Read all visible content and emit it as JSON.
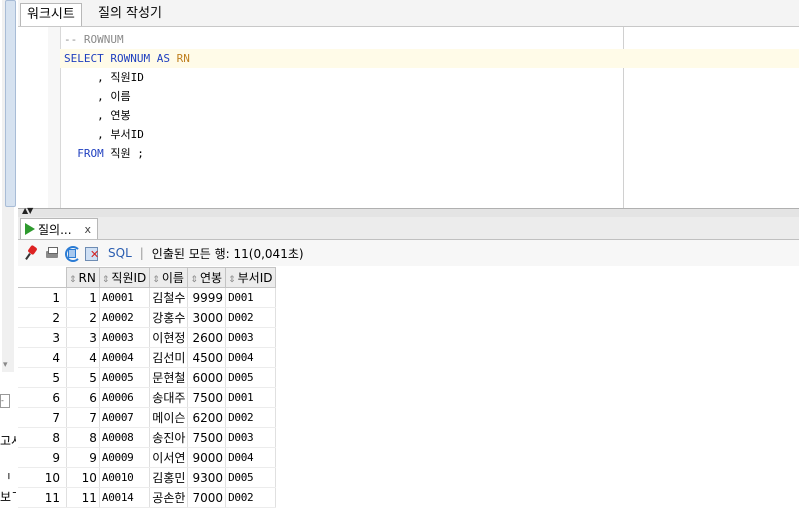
{
  "worksheet": {
    "tabs": [
      {
        "label": "워크시트"
      },
      {
        "label": "질의 작성기"
      }
    ]
  },
  "editor": {
    "lines": [
      {
        "type": "comment",
        "text": "-- ROWNUM"
      },
      {
        "type": "select",
        "kw": "SELECT ROWNUM AS",
        "alias": "RN"
      },
      {
        "type": "plain",
        "text": "     , 직원ID"
      },
      {
        "type": "plain",
        "text": "     , 이름"
      },
      {
        "type": "plain",
        "text": "     , 연봉"
      },
      {
        "type": "plain",
        "text": "     , 부서ID"
      },
      {
        "type": "from",
        "kw": "FROM",
        "rest": " 직원 ;"
      }
    ]
  },
  "left_panel": {
    "cut_texts": [
      "고시",
      "ᅵ",
      "보ᄀ"
    ]
  },
  "results": {
    "tab_label": "질의...",
    "tab_close": "x",
    "toolbar": {
      "sql_label": "SQL",
      "separator": "|",
      "status": "인출된 모든 행: 11(0,041초)"
    },
    "columns": [
      "RN",
      "직원ID",
      "이름",
      "연봉",
      "부서ID"
    ],
    "rows": [
      {
        "n": "1",
        "RN": "1",
        "ID": "A0001",
        "NAME": "김철수",
        "SAL": "9999",
        "DEPT": "D001"
      },
      {
        "n": "2",
        "RN": "2",
        "ID": "A0002",
        "NAME": "강홍수",
        "SAL": "3000",
        "DEPT": "D002"
      },
      {
        "n": "3",
        "RN": "3",
        "ID": "A0003",
        "NAME": "이현정",
        "SAL": "2600",
        "DEPT": "D003"
      },
      {
        "n": "4",
        "RN": "4",
        "ID": "A0004",
        "NAME": "김선미",
        "SAL": "4500",
        "DEPT": "D004"
      },
      {
        "n": "5",
        "RN": "5",
        "ID": "A0005",
        "NAME": "문현철",
        "SAL": "6000",
        "DEPT": "D005"
      },
      {
        "n": "6",
        "RN": "6",
        "ID": "A0006",
        "NAME": "송대주",
        "SAL": "7500",
        "DEPT": "D001"
      },
      {
        "n": "7",
        "RN": "7",
        "ID": "A0007",
        "NAME": "메이슨",
        "SAL": "6200",
        "DEPT": "D002"
      },
      {
        "n": "8",
        "RN": "8",
        "ID": "A0008",
        "NAME": "송진아",
        "SAL": "7500",
        "DEPT": "D003"
      },
      {
        "n": "9",
        "RN": "9",
        "ID": "A0009",
        "NAME": "이서연",
        "SAL": "9000",
        "DEPT": "D004"
      },
      {
        "n": "10",
        "RN": "10",
        "ID": "A0010",
        "NAME": "김홍민",
        "SAL": "9300",
        "DEPT": "D005"
      },
      {
        "n": "11",
        "RN": "11",
        "ID": "A0014",
        "NAME": "공손한",
        "SAL": "7000",
        "DEPT": "D002"
      }
    ]
  }
}
